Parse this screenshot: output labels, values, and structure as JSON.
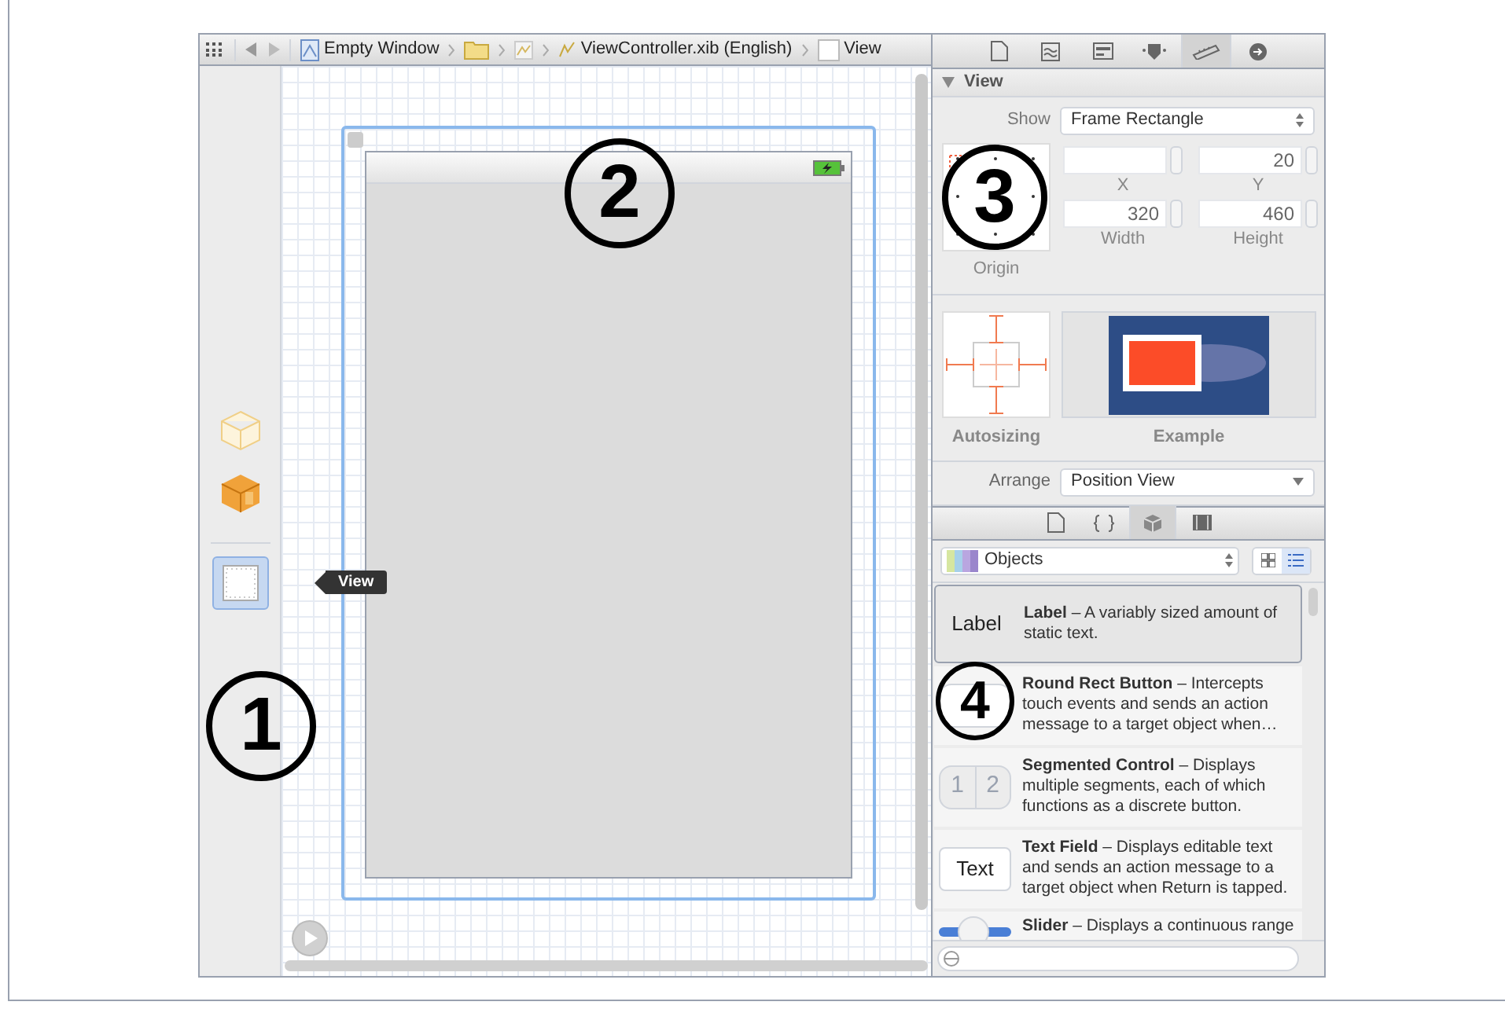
{
  "jump_bar": {
    "items": [
      {
        "kind": "project",
        "label": "Empty Window"
      },
      {
        "kind": "folder"
      },
      {
        "kind": "group"
      },
      {
        "kind": "file",
        "label": "ViewController.xib (English)"
      },
      {
        "kind": "view",
        "label": "View"
      }
    ]
  },
  "dock": {
    "items": [
      {
        "kind": "placeholder",
        "selected": false
      },
      {
        "kind": "owner",
        "selected": false
      },
      {
        "kind": "view",
        "selected": true
      }
    ],
    "tooltip": "View"
  },
  "callouts": [
    "1",
    "2",
    "3",
    "4"
  ],
  "inspector": {
    "tabs": [
      {
        "kind": "file",
        "selected": false
      },
      {
        "kind": "help",
        "selected": false
      },
      {
        "kind": "identity",
        "selected": false
      },
      {
        "kind": "attributes",
        "selected": false
      },
      {
        "kind": "size",
        "selected": true
      },
      {
        "kind": "connections",
        "selected": false
      }
    ],
    "section": {
      "title": "View",
      "expanded": true
    },
    "show": {
      "label": "Show",
      "value": "Frame Rectangle"
    },
    "field_rows": [
      [
        {
          "label": "X"
        },
        {
          "label": "Y",
          "value": "20"
        }
      ],
      [
        {
          "label": "Width",
          "value": "320"
        },
        {
          "label": "Height",
          "value": "460"
        }
      ]
    ],
    "origin_label": "Origin",
    "autosizing_label": "Autosizing",
    "example_label": "Example",
    "arrange": {
      "label": "Arrange",
      "value": "Position View"
    }
  },
  "library": {
    "tabs": [
      {
        "kind": "file",
        "selected": false
      },
      {
        "kind": "code",
        "selected": false
      },
      {
        "kind": "objects",
        "selected": true
      },
      {
        "kind": "media",
        "selected": false
      }
    ],
    "popup": "Objects",
    "views": [
      {
        "kind": "grid",
        "selected": false
      },
      {
        "kind": "list",
        "selected": true
      }
    ],
    "items": [
      {
        "kind": "label",
        "preview": "Label",
        "text": "**Label** – A variably sized amount of static text.",
        "selected": true
      },
      {
        "kind": "button",
        "text": "**Round Rect Button** – Intercepts touch events and sends an action message to a target object when…",
        "selected": false
      },
      {
        "kind": "segmented",
        "segments": [
          "1",
          "2"
        ],
        "text": "**Segmented Control** – Displays multiple segments, each of which functions as a discrete button.",
        "selected": false
      },
      {
        "kind": "textfield",
        "preview": "Text",
        "text": "**Text Field** – Displays editable text and sends an action message to a target object when Return is tapped.",
        "selected": false
      },
      {
        "kind": "slider",
        "text": "**Slider** – Displays a continuous range",
        "selected": false
      }
    ]
  }
}
